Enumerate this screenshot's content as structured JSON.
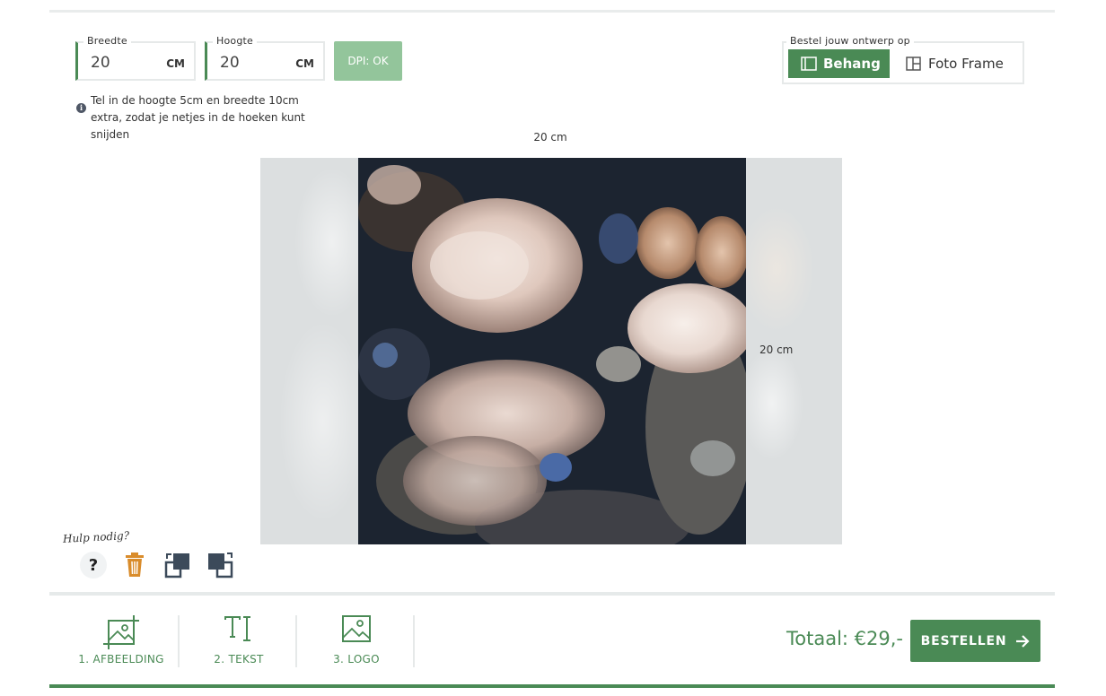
{
  "colors": {
    "accent": "#4a8a55",
    "dpi_ok": "#93c59b",
    "trash": "#d98c2b"
  },
  "dimensions": {
    "width": {
      "label": "Breedte",
      "value": "20",
      "unit": "CM"
    },
    "height": {
      "label": "Hoogte",
      "value": "20",
      "unit": "CM"
    },
    "dpi_label": "DPI: OK",
    "info_icon": "info-icon",
    "info_text": "Tel in de hoogte 5cm en breedte 10cm extra, zodat je netjes in de hoeken kunt snijden"
  },
  "order_type": {
    "label": "Bestel jouw ontwerp op",
    "options": [
      {
        "label": "Behang",
        "icon": "wallpaper-icon",
        "selected": true
      },
      {
        "label": "Foto Frame",
        "icon": "frame-icon",
        "selected": false
      }
    ]
  },
  "canvas": {
    "width_label": "20 cm",
    "height_label": "20 cm"
  },
  "helper": {
    "text": "Hulp nodig?",
    "tools": [
      "help-icon",
      "trash-icon",
      "bring-forward-icon",
      "send-backward-icon"
    ]
  },
  "steps": [
    {
      "label": "1. AFBEELDING",
      "icon": "image-crop-icon"
    },
    {
      "label": "2. TEKST",
      "icon": "text-icon"
    },
    {
      "label": "3. LOGO",
      "icon": "logo-image-icon"
    }
  ],
  "footer": {
    "total": "Totaal: €29,-",
    "order_button": "BESTELLEN"
  }
}
